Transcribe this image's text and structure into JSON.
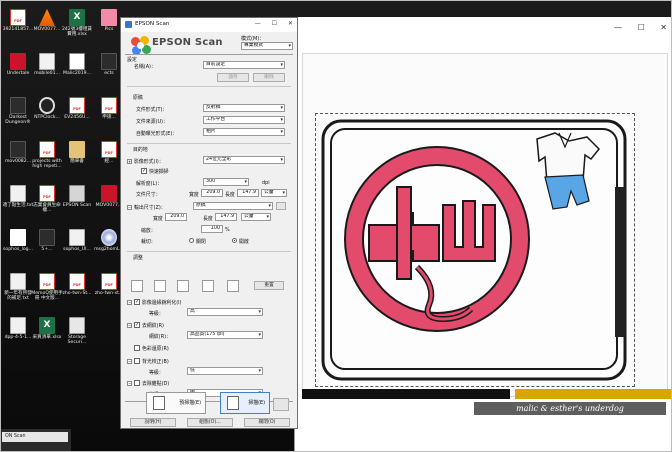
{
  "desktop_icons": [
    {
      "name": "pdf-1",
      "label": "392141857...",
      "kind": "pdf"
    },
    {
      "name": "vlc",
      "label": "MOV0077...",
      "kind": "vlc"
    },
    {
      "name": "xlsx-1",
      "label": "242號3樓租賃費用.xlsx",
      "kind": "xls"
    },
    {
      "name": "pics",
      "label": "Pics",
      "kind": "pink"
    },
    {
      "name": "undertale",
      "label": "Undertale",
      "kind": "red"
    },
    {
      "name": "mobile",
      "label": "mobile01...",
      "kind": "file"
    },
    {
      "name": "actions",
      "label": "Malic2019...",
      "kind": "actions"
    },
    {
      "name": "ects",
      "label": "ects",
      "kind": "dark"
    },
    {
      "name": "darkest",
      "label": "Darkest Dungeon®",
      "kind": "dark"
    },
    {
      "name": "ntp",
      "label": "NTPClock...",
      "kind": "ntp"
    },
    {
      "name": "ev",
      "label": "EV2456U...",
      "kind": "pdf"
    },
    {
      "name": "shenbao",
      "label": "申請...",
      "kind": "pdf"
    },
    {
      "name": "mov2",
      "label": "mov0082...",
      "kind": "dark"
    },
    {
      "name": "projects",
      "label": "projects with high repeti...",
      "kind": "pdf"
    },
    {
      "name": "book",
      "label": "簡單書",
      "kind": "book"
    },
    {
      "name": "jingwei",
      "label": "經...",
      "kind": "pdf"
    },
    {
      "name": "shiyu",
      "label": "適了點生活.txt",
      "kind": "file"
    },
    {
      "name": "zhiye",
      "label": "志業會員生命權...",
      "kind": "pdf"
    },
    {
      "name": "epson-scan",
      "label": "EPSON Scan",
      "kind": "scan"
    },
    {
      "name": "mov3",
      "label": "MOV0077...",
      "kind": "red"
    },
    {
      "name": "sophos-logo",
      "label": "sophos_log...",
      "kind": "bw"
    },
    {
      "name": "s5",
      "label": "5+...",
      "kind": "dark"
    },
    {
      "name": "sophos-ui",
      "label": "sophos_UI...",
      "kind": "file"
    },
    {
      "name": "msg",
      "label": "msg2homL...",
      "kind": "disc"
    },
    {
      "name": "yinian",
      "label": "新一年有所發的補足.txt",
      "kind": "file"
    },
    {
      "name": "memo",
      "label": "MemoQ使用手冊 中文版...",
      "kind": "pdf"
    },
    {
      "name": "zho1",
      "label": "zho-twn-St...",
      "kind": "pdf"
    },
    {
      "name": "zho2",
      "label": "zho-twn-st...",
      "kind": "pdf"
    },
    {
      "name": "dpp",
      "label": "dpp-4-5-1...",
      "kind": "file"
    },
    {
      "name": "caimai",
      "label": "采買清單.xlsx",
      "kind": "xls"
    },
    {
      "name": "storage",
      "label": "Storage Securi...",
      "kind": "srv"
    }
  ],
  "epson_window": {
    "title": "EPSON Scan",
    "brand": "EPSON Scan",
    "mode_label": "模式(M)：",
    "mode_value": "專業模式",
    "settings_header": "設定",
    "name_label": "名稱(A)：",
    "name_value": "目前設定",
    "save_button": "儲存",
    "delete_button": "刪除",
    "original_header": "原稿",
    "doc_type_label": "文件形式(T)：",
    "doc_type_value": "反射稿",
    "doc_source_label": "文件來源(U)：",
    "doc_source_value": "工作平台",
    "auto_exposure_label": "自動曝光形式(E)：",
    "auto_exposure_value": "相片",
    "destination_header": "目的地",
    "image_type_label": "影像形式(I)：",
    "image_type_value": "24位元全彩",
    "fast_preview_label": "快速擷掃",
    "resolution_label": "解析度(L)：",
    "resolution_value": "300",
    "resolution_unit": "dpi",
    "doc_size_label": "文件尺寸：",
    "width_label": "寬度",
    "width_value": "209.0",
    "height_label": "長度",
    "height_value": "147.9",
    "unit_value": "公釐",
    "output_size_label": "輸出尺寸(Z)：",
    "output_size_value": "原稿",
    "out_width_value": "209.0",
    "out_height_value": "147.9",
    "scale_label": "縮放：",
    "scale_value": "100",
    "scale_unit": "%",
    "trim_label": "裁切：",
    "trim_off": "關閉",
    "trim_on": "開啟",
    "adjust_header": "調整",
    "reset_button": "重置",
    "unsharp_label": "影像邊緣銳利化(I)",
    "level_label": "等級：",
    "unsharp_level": "高",
    "descreen_label": "去網紋(R)",
    "screen_label": "網紋(R)：",
    "screen_value": "高品質(175 lpi)",
    "color_restore_label": "色彩還原(R)",
    "backlight_label": "背光校正(B)",
    "backlight_level": "低",
    "dust_label": "去除雜點(D)",
    "dust_level": "中",
    "preview_button": "預掃描(E)",
    "scan_button": "掃描(E)",
    "help_button": "說明(H)",
    "config_button": "組態(O)...",
    "close_button": "關閉(O)"
  },
  "taskbar_item": "ON Scan",
  "watermark": "malic & esther's underdog",
  "colors": {
    "accent": "#3c7fd4",
    "stamp_pink": "#e34b6d",
    "shorts_blue": "#58a6e6",
    "bar_yellow": "#d7a700"
  }
}
